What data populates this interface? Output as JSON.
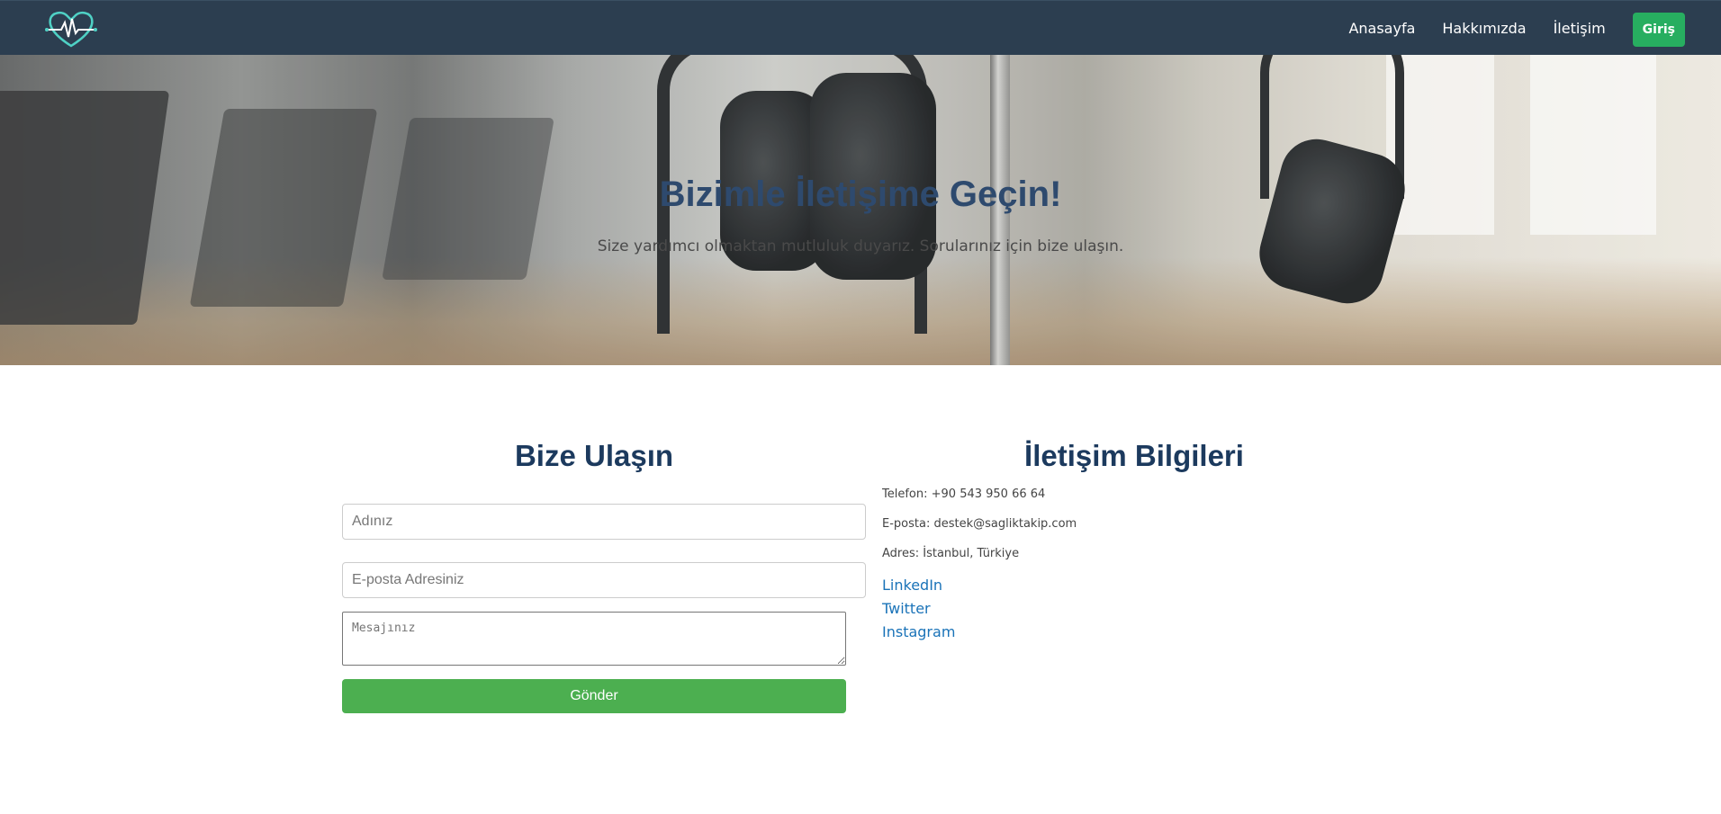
{
  "nav": {
    "logo_icon": "heart-pulse-icon",
    "links": [
      "Anasayfa",
      "Hakkımızda",
      "İletişim"
    ],
    "login_label": "Giriş",
    "bg_color": "#2c3e50",
    "login_color": "#27ae60"
  },
  "hero": {
    "title": "Bizimle İletişime Geçin!",
    "subtitle": "Size yardımcı olmaktan mutluluk duyarız. Sorularınız için bize ulaşın."
  },
  "contact_form": {
    "title": "Bize Ulaşın",
    "name_placeholder": "Adınız",
    "email_placeholder": "E-posta Adresiniz",
    "message_placeholder": "Mesajınız",
    "submit_label": "Gönder",
    "submit_color": "#4caf50"
  },
  "contact_info": {
    "title": "İletişim Bilgileri",
    "phone": "Telefon: +90 543 950 66 64",
    "email": "E-posta: destek@sagliktakip.com",
    "address": "Adres: İstanbul, Türkiye",
    "social": [
      "LinkedIn",
      "Twitter",
      "Instagram"
    ]
  }
}
